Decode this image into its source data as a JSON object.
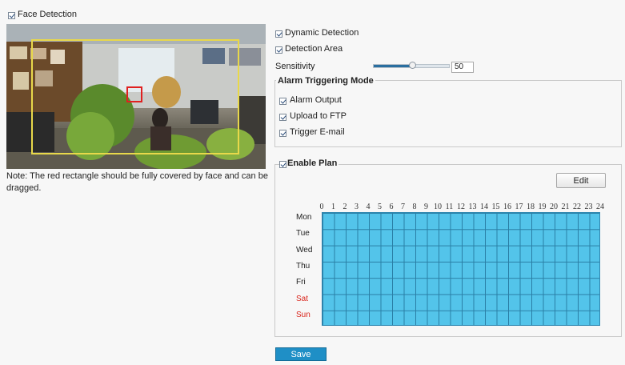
{
  "face_detection": {
    "label": "Face Detection",
    "checked": true
  },
  "note": {
    "line1": "Note: The red rectangle should be fully covered by face and can be",
    "line2": "dragged."
  },
  "settings": {
    "dynamic_detection": "Dynamic Detection",
    "detection_area": "Detection Area",
    "sensitivity_label": "Sensitivity",
    "sensitivity_value": "50",
    "sensitivity_fraction": 0.5
  },
  "alarm": {
    "legend": "Alarm Triggering Mode",
    "alarm_output": "Alarm Output",
    "upload_ftp": "Upload to FTP",
    "trigger_email": "Trigger E-mail"
  },
  "plan": {
    "legend": "Enable Plan",
    "edit_label": "Edit",
    "hours": [
      "0",
      "1",
      "2",
      "3",
      "4",
      "5",
      "6",
      "7",
      "8",
      "9",
      "10",
      "11",
      "12",
      "13",
      "14",
      "15",
      "16",
      "17",
      "18",
      "19",
      "20",
      "21",
      "22",
      "23",
      "24"
    ],
    "days": [
      {
        "label": "Mon",
        "weekend": false
      },
      {
        "label": "Tue",
        "weekend": false
      },
      {
        "label": "Wed",
        "weekend": false
      },
      {
        "label": "Thu",
        "weekend": false
      },
      {
        "label": "Fri",
        "weekend": false
      },
      {
        "label": "Sat",
        "weekend": true
      },
      {
        "label": "Sun",
        "weekend": true
      }
    ],
    "schedule_color": "#53c4ea",
    "weekend_color": "#d9251c"
  },
  "save_label": "Save",
  "colors": {
    "accent": "#1f8fc6",
    "detection_box": "#e8d84a",
    "face_rect": "#e02020"
  }
}
